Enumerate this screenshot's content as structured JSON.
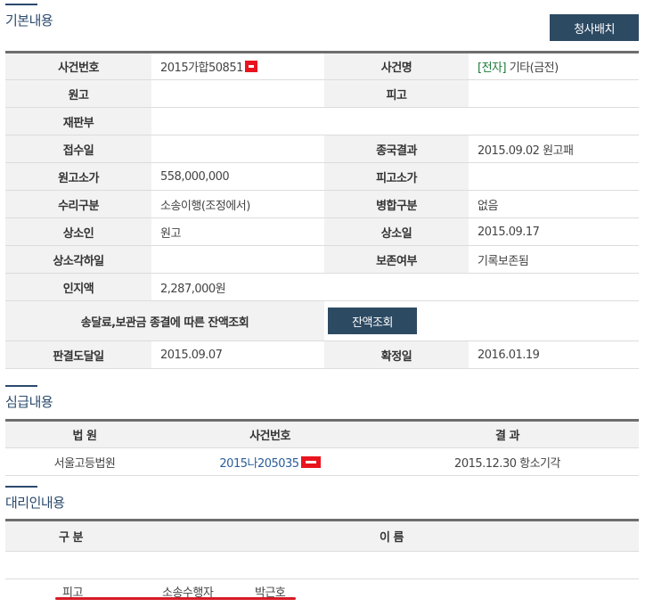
{
  "basic": {
    "title": "기본내용",
    "button_label": "청사배치",
    "rows": [
      {
        "l1": "사건번호",
        "v1": "2015가합50851",
        "l2": "사건명",
        "v2_prefix": "[전자]",
        "v2": " 기타(금전)"
      },
      {
        "l1": "원고",
        "v1": "",
        "l2": "피고",
        "v2": ""
      },
      {
        "l1": "재판부",
        "v1": ""
      },
      {
        "l1": "접수일",
        "v1": "",
        "l2": "종국결과",
        "v2": "2015.09.02 원고패"
      },
      {
        "l1": "원고소가",
        "v1": "558,000,000",
        "l2": "피고소가",
        "v2": ""
      },
      {
        "l1": "수리구분",
        "v1": "소송이행(조정에서)",
        "l2": "병합구분",
        "v2": "없음"
      },
      {
        "l1": "상소인",
        "v1": "원고",
        "l2": "상소일",
        "v2": "2015.09.17"
      },
      {
        "l1": "상소각하일",
        "v1": "",
        "l2": "보존여부",
        "v2": "기록보존됨"
      },
      {
        "l1": "인지액",
        "v1": "2,287,000원"
      }
    ],
    "balance_label": "송달료,보관금 종결에 따른 잔액조회",
    "balance_button": "잔액조회",
    "final_row": {
      "l1": "판결도달일",
      "v1": "2015.09.07",
      "l2": "확정일",
      "v2": "2016.01.19"
    }
  },
  "trial": {
    "title": "심급내용",
    "headers": [
      "법 원",
      "사건번호",
      "결 과"
    ],
    "rows": [
      {
        "court": "서울고등법원",
        "case_no": "2015나205035",
        "result": "2015.12.30 항소기각"
      }
    ]
  },
  "agent": {
    "title": "대리인내용",
    "headers": [
      "구 분",
      "이 름"
    ],
    "rows": [
      {
        "type": "피고",
        "role": "소송수행자",
        "name": "박근호"
      }
    ]
  },
  "colors": {
    "accent": "#2a4a6d",
    "button": "#2d4a63",
    "label_bg": "#f2f2f2",
    "highlight_green": "#1d7a3a",
    "redaction_red": "#e8141e",
    "underline_red": "#d71a26"
  }
}
